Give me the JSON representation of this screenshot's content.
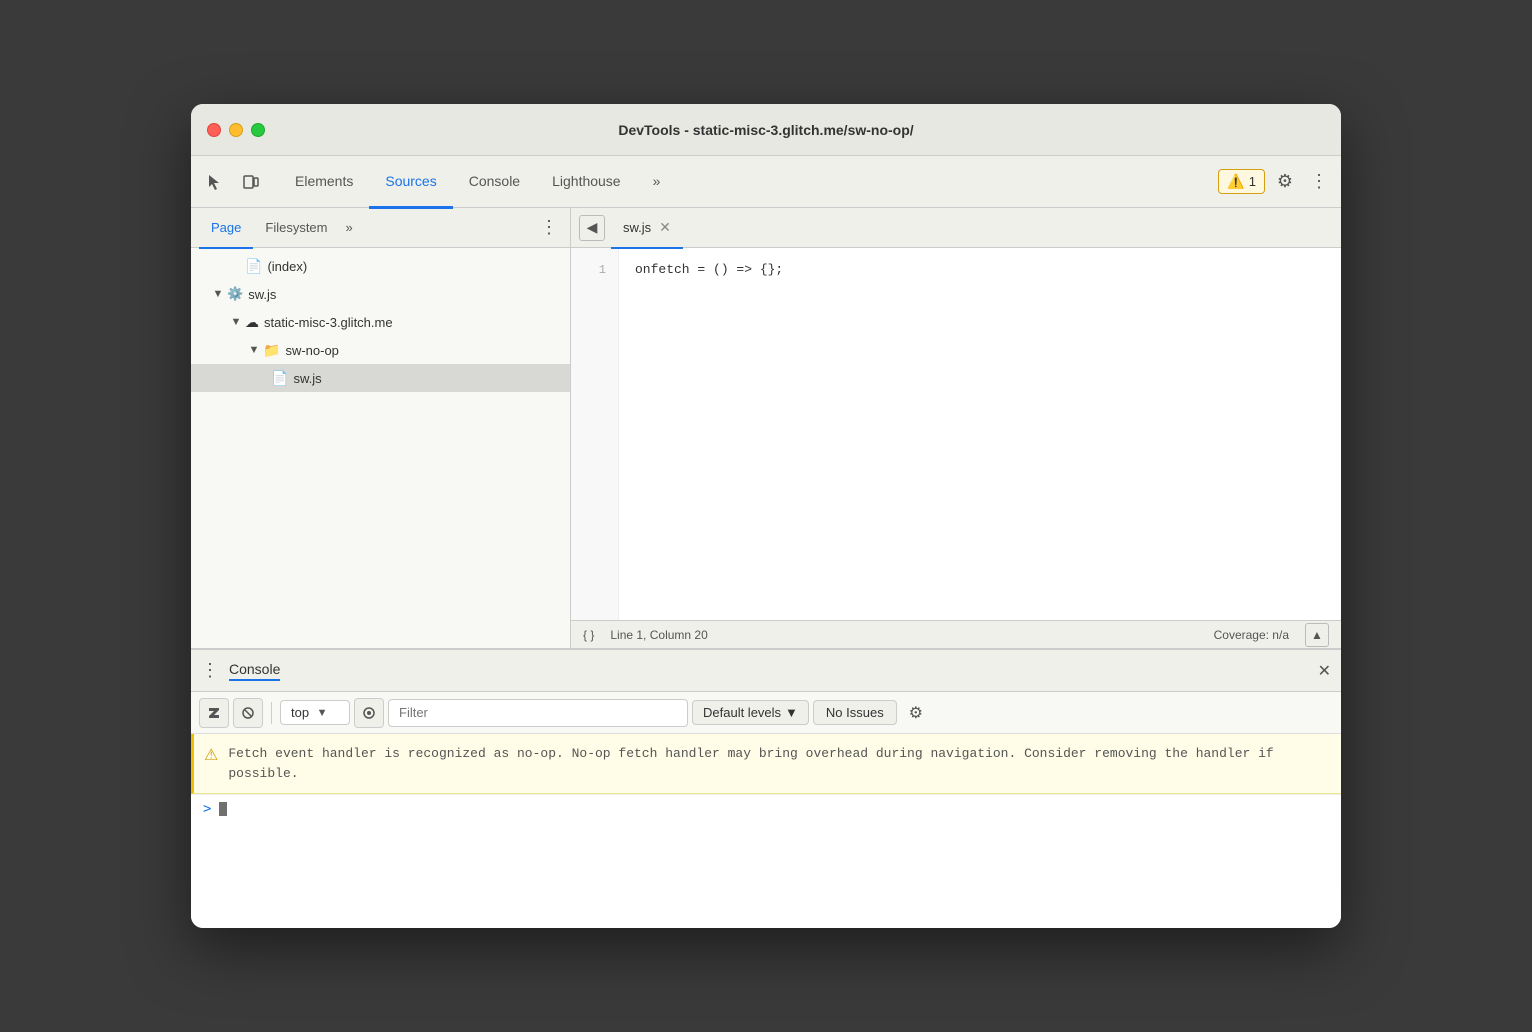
{
  "window": {
    "title": "DevTools - static-misc-3.glitch.me/sw-no-op/"
  },
  "toolbar": {
    "tabs": [
      {
        "id": "elements",
        "label": "Elements",
        "active": false
      },
      {
        "id": "sources",
        "label": "Sources",
        "active": true
      },
      {
        "id": "console",
        "label": "Console",
        "active": false
      },
      {
        "id": "lighthouse",
        "label": "Lighthouse",
        "active": false
      },
      {
        "id": "more",
        "label": "»",
        "active": false
      }
    ],
    "warn_count": "1",
    "more_tabs_label": "»"
  },
  "left_panel": {
    "tabs": [
      {
        "id": "page",
        "label": "Page",
        "active": true
      },
      {
        "id": "filesystem",
        "label": "Filesystem",
        "active": false
      },
      {
        "id": "more",
        "label": "»"
      }
    ],
    "file_tree": [
      {
        "id": "index",
        "label": "(index)",
        "indent": 3,
        "type": "file",
        "icon": "📄"
      },
      {
        "id": "swjs-root",
        "label": "sw.js",
        "indent": 2,
        "type": "service-worker",
        "arrow": "▼",
        "icon": "⚙️"
      },
      {
        "id": "domain",
        "label": "static-misc-3.glitch.me",
        "indent": 3,
        "type": "domain",
        "arrow": "▼",
        "icon": "☁"
      },
      {
        "id": "sw-no-op-folder",
        "label": "sw-no-op",
        "indent": 4,
        "type": "folder",
        "arrow": "▼",
        "icon": "📁",
        "icon_color": "#4a90d9"
      },
      {
        "id": "swjs-file",
        "label": "sw.js",
        "indent": 5,
        "type": "js-file",
        "icon": "📄",
        "icon_color": "#f5c542",
        "selected": true
      }
    ]
  },
  "editor": {
    "file_name": "sw.js",
    "code_lines": [
      {
        "number": "1",
        "code": "onfetch = () => {};"
      }
    ],
    "status": {
      "line": "Line 1, Column 20",
      "coverage": "Coverage: n/a"
    }
  },
  "console_panel": {
    "title": "Console",
    "toolbar": {
      "top_label": "top",
      "filter_placeholder": "Filter",
      "default_levels_label": "Default levels",
      "no_issues_label": "No Issues"
    },
    "warning_message": "Fetch event handler is recognized as no-op. No-op fetch handler may bring overhead during navigation. Consider removing the handler if possible."
  }
}
